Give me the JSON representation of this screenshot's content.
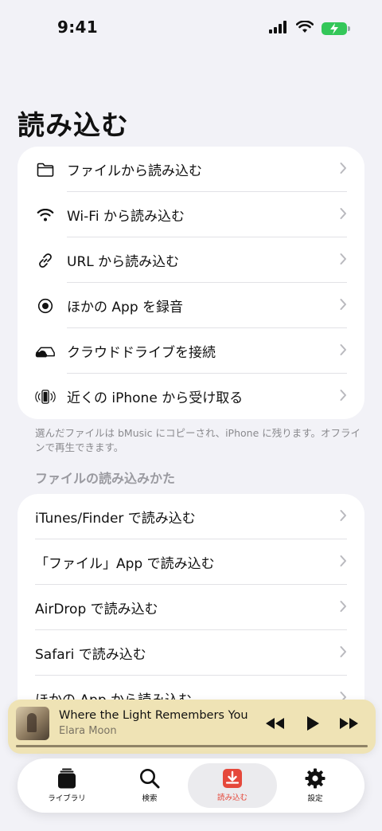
{
  "status_bar": {
    "time": "9:41"
  },
  "page": {
    "title": "読み込む"
  },
  "import_options": [
    {
      "label": "ファイルから読み込む",
      "icon": "folder-icon"
    },
    {
      "label": "Wi-Fi から読み込む",
      "icon": "wifi-icon"
    },
    {
      "label": "URL から読み込む",
      "icon": "link-icon"
    },
    {
      "label": "ほかの App を録音",
      "icon": "record-icon"
    },
    {
      "label": "クラウドドライブを接続",
      "icon": "cloud-drive-icon"
    },
    {
      "label": "近くの iPhone から受け取る",
      "icon": "nearby-iphone-icon"
    }
  ],
  "footnote": "選んだファイルは bMusic にコピーされ、iPhone に残ります。オフラインで再生できます。",
  "methods_section": {
    "header": "ファイルの読み込みかた",
    "items": [
      {
        "label": "iTunes/Finder で読み込む"
      },
      {
        "label": "「ファイル」App で読み込む"
      },
      {
        "label": "AirDrop で読み込む"
      },
      {
        "label": "Safari で読み込む"
      },
      {
        "label": "ほかの App から読み込む"
      }
    ]
  },
  "now_playing": {
    "title": "Where the Light Remembers You",
    "artist": "Elara Moon",
    "progress": 1.0
  },
  "tab_bar": {
    "tabs": [
      {
        "label": "ライブラリ",
        "icon": "library-icon"
      },
      {
        "label": "検索",
        "icon": "search-icon"
      },
      {
        "label": "読み込む",
        "icon": "import-icon",
        "selected": true
      },
      {
        "label": "設定",
        "icon": "gear-icon"
      }
    ]
  },
  "colors": {
    "accent": "#e5483b",
    "background": "#f2f2f7",
    "player_background": "#efe3b5",
    "battery": "#34c759"
  }
}
